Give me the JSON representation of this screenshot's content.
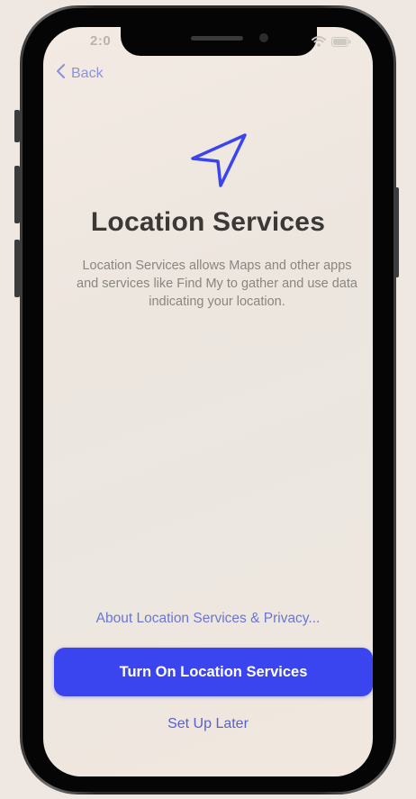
{
  "status_bar": {
    "time": "2:0",
    "icons": [
      "wifi-icon",
      "battery-icon"
    ]
  },
  "nav": {
    "back_label": "Back",
    "back_icon": "chevron-left-icon"
  },
  "hero": {
    "icon": "location-arrow-icon"
  },
  "content": {
    "title": "Location Services",
    "description": "Location Services allows Maps and other apps and services like Find My to gather and use data indicating your location."
  },
  "actions": {
    "privacy_link": "About Location Services & Privacy...",
    "primary_button": "Turn On Location Services",
    "secondary_link": "Set Up Later"
  },
  "colors": {
    "accent": "#3a45f0",
    "link": "#6b76d0",
    "title": "#3b3836",
    "body_text": "#8a8580"
  }
}
